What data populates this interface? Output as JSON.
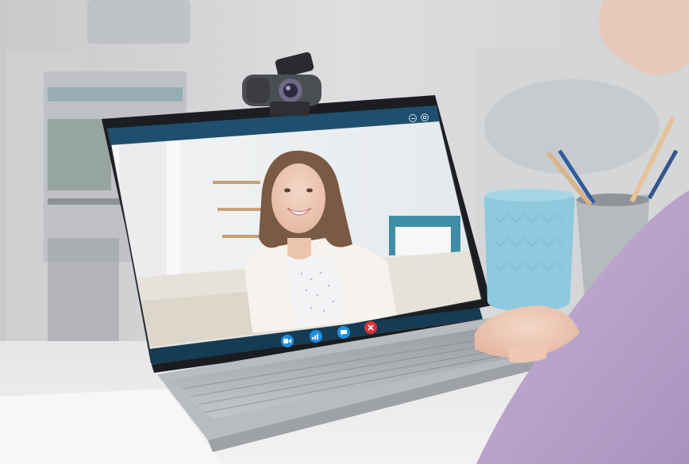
{
  "scene": {
    "description_icons": {
      "call_controls": [
        "video-camera-icon",
        "audio-wave-icon",
        "chat-bubble-icon",
        "end-call-icon"
      ],
      "window_controls": [
        "minimize-icon",
        "fullscreen-icon"
      ]
    },
    "colors": {
      "video_button": "#1f8fe0",
      "end_call_button": "#e0313a",
      "call_header_bar": "#1f4f6e",
      "call_bottom_bar": "#153b55",
      "mug": "#8ec9dd"
    }
  }
}
